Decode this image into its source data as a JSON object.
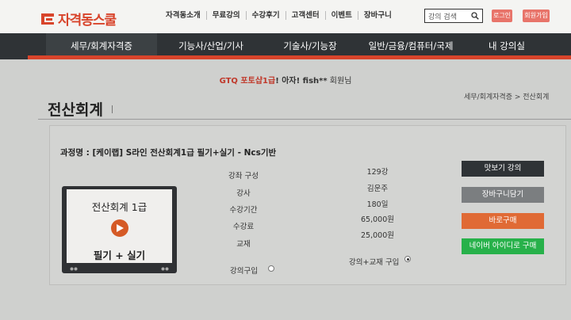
{
  "header": {
    "logo_text": "자격동스쿨",
    "nav": [
      "자격동소개",
      "무료강의",
      "수강후기",
      "고객센터",
      "이벤트",
      "장바구니"
    ],
    "search_placeholder": "강의 검색",
    "login_label": "로그인",
    "signup_label": "회원가입"
  },
  "categories": [
    {
      "label": "세무/회계자격증",
      "active": true
    },
    {
      "label": "기능사/산업/기사",
      "active": false
    },
    {
      "label": "기술사/기능장",
      "active": false
    },
    {
      "label": "일반/금융/컴퓨터/국제",
      "active": false
    },
    {
      "label": "내 강의실",
      "active": false
    }
  ],
  "welcome": {
    "highlight": "GTQ 포토샵1급",
    "mid": "! 아자! ",
    "user": "fish**",
    "suffix": " 회원님"
  },
  "breadcrumb": "세무/회계자격증 > 전산회계",
  "page_title": "전산회계",
  "course": {
    "name": "과정명 : [케이랩] S라인 전산회계1급 필기+실기 - Ncs기반",
    "thumb_top": "전산회계 1급",
    "thumb_bottom": "필기 + 실기",
    "info": [
      {
        "label": "강좌 구성",
        "value": "129강"
      },
      {
        "label": "강사",
        "value": "김운주"
      },
      {
        "label": "수강기간",
        "value": "180일"
      },
      {
        "label": "수강료",
        "value": "65,000원"
      },
      {
        "label": "교재",
        "value": "25,000원"
      }
    ],
    "options": [
      {
        "label": "강의구입",
        "selected": false
      },
      {
        "label": "강의+교재 구입",
        "selected": true
      }
    ]
  },
  "buttons": {
    "preview": "맛보기 강의",
    "cart": "장바구니담기",
    "buy_now": "바로구매",
    "naver_buy": "네이버 아이디로 구매"
  },
  "colors": {
    "brand": "#d8442b",
    "nav_bar": "#2f3336",
    "preview_btn": "#2f3336",
    "cart_btn": "#7b7e80",
    "buy_btn": "#e06a35",
    "naver_btn": "#27b14a"
  }
}
